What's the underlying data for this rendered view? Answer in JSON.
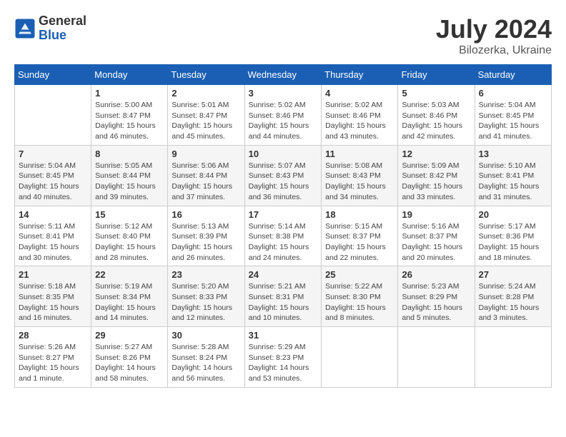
{
  "header": {
    "logo_general": "General",
    "logo_blue": "Blue",
    "title": "July 2024",
    "location": "Bilozerka, Ukraine"
  },
  "weekdays": [
    "Sunday",
    "Monday",
    "Tuesday",
    "Wednesday",
    "Thursday",
    "Friday",
    "Saturday"
  ],
  "weeks": [
    [
      {
        "day": "",
        "info": ""
      },
      {
        "day": "1",
        "info": "Sunrise: 5:00 AM\nSunset: 8:47 PM\nDaylight: 15 hours\nand 46 minutes."
      },
      {
        "day": "2",
        "info": "Sunrise: 5:01 AM\nSunset: 8:47 PM\nDaylight: 15 hours\nand 45 minutes."
      },
      {
        "day": "3",
        "info": "Sunrise: 5:02 AM\nSunset: 8:46 PM\nDaylight: 15 hours\nand 44 minutes."
      },
      {
        "day": "4",
        "info": "Sunrise: 5:02 AM\nSunset: 8:46 PM\nDaylight: 15 hours\nand 43 minutes."
      },
      {
        "day": "5",
        "info": "Sunrise: 5:03 AM\nSunset: 8:46 PM\nDaylight: 15 hours\nand 42 minutes."
      },
      {
        "day": "6",
        "info": "Sunrise: 5:04 AM\nSunset: 8:45 PM\nDaylight: 15 hours\nand 41 minutes."
      }
    ],
    [
      {
        "day": "7",
        "info": "Sunrise: 5:04 AM\nSunset: 8:45 PM\nDaylight: 15 hours\nand 40 minutes."
      },
      {
        "day": "8",
        "info": "Sunrise: 5:05 AM\nSunset: 8:44 PM\nDaylight: 15 hours\nand 39 minutes."
      },
      {
        "day": "9",
        "info": "Sunrise: 5:06 AM\nSunset: 8:44 PM\nDaylight: 15 hours\nand 37 minutes."
      },
      {
        "day": "10",
        "info": "Sunrise: 5:07 AM\nSunset: 8:43 PM\nDaylight: 15 hours\nand 36 minutes."
      },
      {
        "day": "11",
        "info": "Sunrise: 5:08 AM\nSunset: 8:43 PM\nDaylight: 15 hours\nand 34 minutes."
      },
      {
        "day": "12",
        "info": "Sunrise: 5:09 AM\nSunset: 8:42 PM\nDaylight: 15 hours\nand 33 minutes."
      },
      {
        "day": "13",
        "info": "Sunrise: 5:10 AM\nSunset: 8:41 PM\nDaylight: 15 hours\nand 31 minutes."
      }
    ],
    [
      {
        "day": "14",
        "info": "Sunrise: 5:11 AM\nSunset: 8:41 PM\nDaylight: 15 hours\nand 30 minutes."
      },
      {
        "day": "15",
        "info": "Sunrise: 5:12 AM\nSunset: 8:40 PM\nDaylight: 15 hours\nand 28 minutes."
      },
      {
        "day": "16",
        "info": "Sunrise: 5:13 AM\nSunset: 8:39 PM\nDaylight: 15 hours\nand 26 minutes."
      },
      {
        "day": "17",
        "info": "Sunrise: 5:14 AM\nSunset: 8:38 PM\nDaylight: 15 hours\nand 24 minutes."
      },
      {
        "day": "18",
        "info": "Sunrise: 5:15 AM\nSunset: 8:37 PM\nDaylight: 15 hours\nand 22 minutes."
      },
      {
        "day": "19",
        "info": "Sunrise: 5:16 AM\nSunset: 8:37 PM\nDaylight: 15 hours\nand 20 minutes."
      },
      {
        "day": "20",
        "info": "Sunrise: 5:17 AM\nSunset: 8:36 PM\nDaylight: 15 hours\nand 18 minutes."
      }
    ],
    [
      {
        "day": "21",
        "info": "Sunrise: 5:18 AM\nSunset: 8:35 PM\nDaylight: 15 hours\nand 16 minutes."
      },
      {
        "day": "22",
        "info": "Sunrise: 5:19 AM\nSunset: 8:34 PM\nDaylight: 15 hours\nand 14 minutes."
      },
      {
        "day": "23",
        "info": "Sunrise: 5:20 AM\nSunset: 8:33 PM\nDaylight: 15 hours\nand 12 minutes."
      },
      {
        "day": "24",
        "info": "Sunrise: 5:21 AM\nSunset: 8:31 PM\nDaylight: 15 hours\nand 10 minutes."
      },
      {
        "day": "25",
        "info": "Sunrise: 5:22 AM\nSunset: 8:30 PM\nDaylight: 15 hours\nand 8 minutes."
      },
      {
        "day": "26",
        "info": "Sunrise: 5:23 AM\nSunset: 8:29 PM\nDaylight: 15 hours\nand 5 minutes."
      },
      {
        "day": "27",
        "info": "Sunrise: 5:24 AM\nSunset: 8:28 PM\nDaylight: 15 hours\nand 3 minutes."
      }
    ],
    [
      {
        "day": "28",
        "info": "Sunrise: 5:26 AM\nSunset: 8:27 PM\nDaylight: 15 hours\nand 1 minute."
      },
      {
        "day": "29",
        "info": "Sunrise: 5:27 AM\nSunset: 8:26 PM\nDaylight: 14 hours\nand 58 minutes."
      },
      {
        "day": "30",
        "info": "Sunrise: 5:28 AM\nSunset: 8:24 PM\nDaylight: 14 hours\nand 56 minutes."
      },
      {
        "day": "31",
        "info": "Sunrise: 5:29 AM\nSunset: 8:23 PM\nDaylight: 14 hours\nand 53 minutes."
      },
      {
        "day": "",
        "info": ""
      },
      {
        "day": "",
        "info": ""
      },
      {
        "day": "",
        "info": ""
      }
    ]
  ]
}
